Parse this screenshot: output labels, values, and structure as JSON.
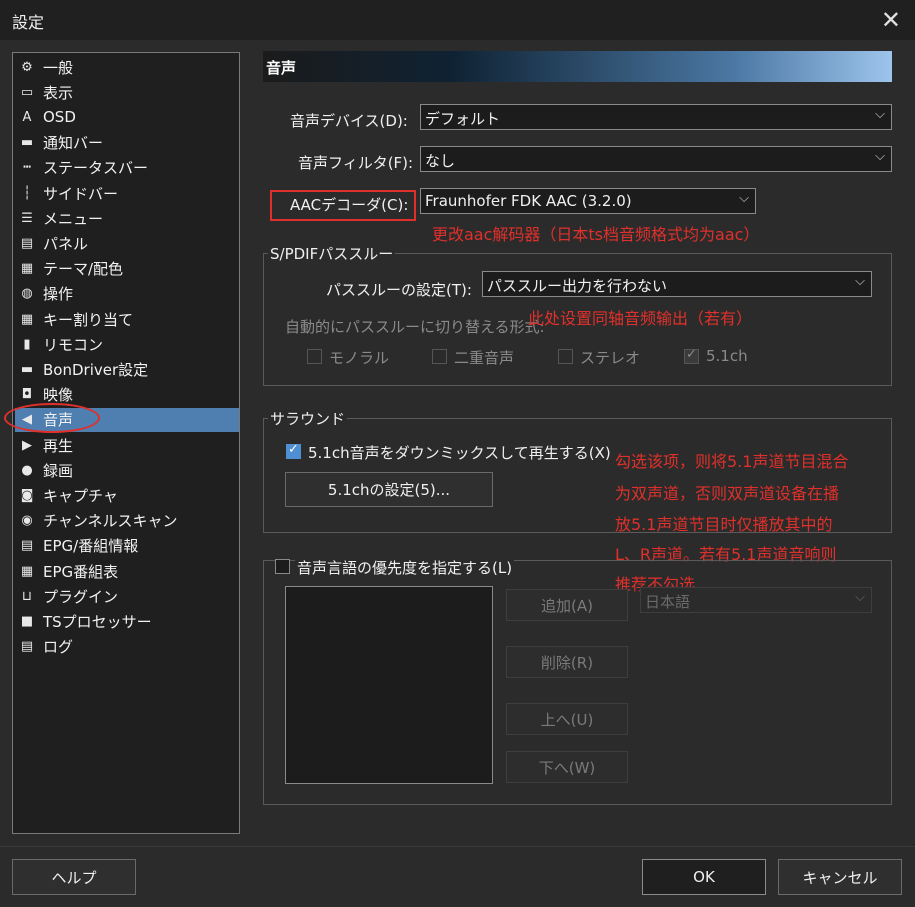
{
  "window": {
    "title": "設定"
  },
  "sidebar": {
    "items": [
      {
        "label": "一般",
        "icon": "gear-icon",
        "glyph": "⚙"
      },
      {
        "label": "表示",
        "icon": "display-icon",
        "glyph": "▭"
      },
      {
        "label": "OSD",
        "icon": "osd-icon",
        "glyph": "A"
      },
      {
        "label": "通知バー",
        "icon": "notify-bar-icon",
        "glyph": "▬"
      },
      {
        "label": "ステータスバー",
        "icon": "status-bar-icon",
        "glyph": "┅"
      },
      {
        "label": "サイドバー",
        "icon": "side-bar-icon",
        "glyph": "┆"
      },
      {
        "label": "メニュー",
        "icon": "menu-icon",
        "glyph": "☰"
      },
      {
        "label": "パネル",
        "icon": "panel-icon",
        "glyph": "▤"
      },
      {
        "label": "テーマ/配色",
        "icon": "theme-icon",
        "glyph": "▦"
      },
      {
        "label": "操作",
        "icon": "mouse-icon",
        "glyph": "◍"
      },
      {
        "label": "キー割り当て",
        "icon": "keyboard-icon",
        "glyph": "▦"
      },
      {
        "label": "リモコン",
        "icon": "remote-icon",
        "glyph": "▮"
      },
      {
        "label": "BonDriver設定",
        "icon": "bondriver-icon",
        "glyph": "▬"
      },
      {
        "label": "映像",
        "icon": "video-icon",
        "glyph": "◘"
      },
      {
        "label": "音声",
        "icon": "speaker-icon",
        "glyph": "◀"
      },
      {
        "label": "再生",
        "icon": "play-icon",
        "glyph": "▶"
      },
      {
        "label": "録画",
        "icon": "record-icon",
        "glyph": "●"
      },
      {
        "label": "キャプチャ",
        "icon": "camera-icon",
        "glyph": "◙"
      },
      {
        "label": "チャンネルスキャン",
        "icon": "scan-icon",
        "glyph": "◉"
      },
      {
        "label": "EPG/番組情報",
        "icon": "epg-info-icon",
        "glyph": "▤"
      },
      {
        "label": "EPG番組表",
        "icon": "epg-table-icon",
        "glyph": "▦"
      },
      {
        "label": "プラグイン",
        "icon": "plugin-icon",
        "glyph": "⊔"
      },
      {
        "label": "TSプロセッサー",
        "icon": "ts-processor-icon",
        "glyph": "■"
      },
      {
        "label": "ログ",
        "icon": "log-icon",
        "glyph": "▤"
      }
    ],
    "selected_index": 14
  },
  "main": {
    "section_title": "音声",
    "audio_device": {
      "label": "音声デバイス(D):",
      "value": "デフォルト"
    },
    "audio_filter": {
      "label": "音声フィルタ(F):",
      "value": "なし"
    },
    "aac_decoder": {
      "label": "AACデコーダ(C):",
      "value": "Fraunhofer FDK AAC (3.2.0)"
    },
    "spdif": {
      "group_title": "S/PDIFパススルー",
      "passthrough_label": "パススルーの設定(T):",
      "passthrough_value": "パススルー出力を行わない",
      "auto_switch_label": "自動的にパススルーに切り替える形式:",
      "mono_label": "モノラル",
      "dual_label": "二重音声",
      "stereo_label": "ステレオ",
      "ch51_label": "5.1ch",
      "ch51_checked": true
    },
    "surround": {
      "group_title": "サラウンド",
      "downmix_label": "5.1ch音声をダウンミックスして再生する(X)",
      "downmix_checked": true,
      "settings_button": "5.1chの設定(5)..."
    },
    "language_priority": {
      "checkbox_label": "音声言語の優先度を指定する(L)",
      "checked": false,
      "add_button": "追加(A)",
      "remove_button": "削除(R)",
      "up_button": "上へ(U)",
      "down_button": "下へ(W)",
      "language_value": "日本語"
    }
  },
  "footer": {
    "help_button": "ヘルプ",
    "ok_button": "OK",
    "cancel_button": "キャンセル"
  },
  "annotations": {
    "aac_note": "更改aac解码器（日本ts档音频格式均为aac）",
    "spdif_note": "此处设置同轴音频输出（若有）",
    "downmix_note_lines": [
      "勾选该项，则将5.1声道节目混合",
      "为双声道，否则双声道设备在播",
      "放5.1声道节目时仅播放其中的",
      "L、R声道。若有5.1声道音响则",
      "推荐不勾选"
    ],
    "color": "#e0302b"
  }
}
